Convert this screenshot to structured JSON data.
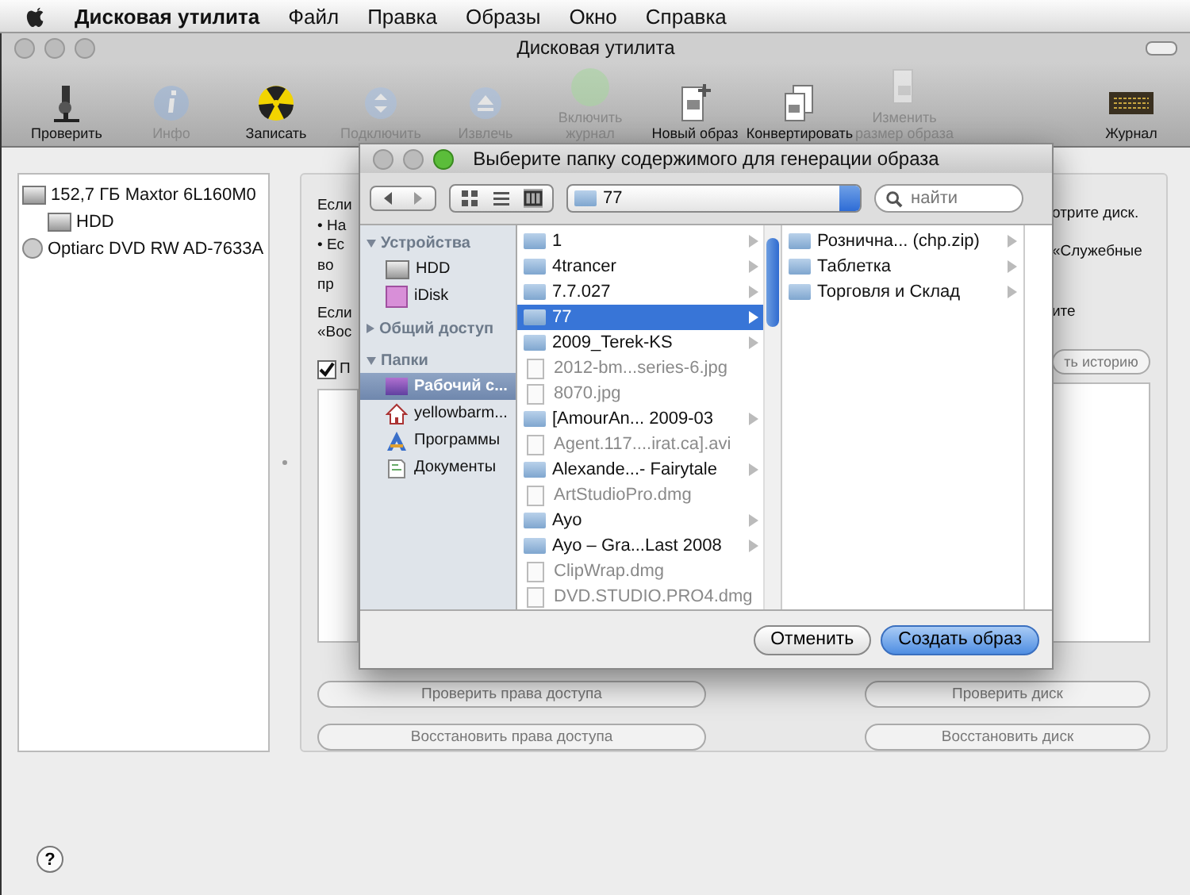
{
  "menu_bar": {
    "app": "Дисковая утилита",
    "items": [
      "Файл",
      "Правка",
      "Образы",
      "Окно",
      "Справка"
    ]
  },
  "window": {
    "title": "Дисковая утилита",
    "help_button": "?"
  },
  "toolbar": [
    {
      "label": "Проверить",
      "kind": "microscope",
      "disabled": false
    },
    {
      "label": "Инфо",
      "kind": "info",
      "disabled": true
    },
    {
      "label": "Записать",
      "kind": "burn",
      "disabled": false
    },
    {
      "label": "Подключить",
      "kind": "mount",
      "disabled": true
    },
    {
      "label": "Извлечь",
      "kind": "eject",
      "disabled": true
    },
    {
      "label": "Включить журнал",
      "kind": "journal",
      "disabled": true
    },
    {
      "label": "Новый образ",
      "kind": "new-image",
      "disabled": false
    },
    {
      "label": "Конвертировать",
      "kind": "convert",
      "disabled": false
    },
    {
      "label": "Изменить размер образа",
      "kind": "resize",
      "disabled": true
    },
    {
      "label": "Журнал",
      "kind": "log",
      "disabled": false
    }
  ],
  "disks": [
    {
      "label": "152,7 ГБ Maxtor 6L160M0",
      "kind": "disk",
      "children": [
        {
          "label": "HDD",
          "kind": "disk"
        }
      ]
    },
    {
      "label": "Optiarc DVD RW AD-7633A",
      "kind": "optical"
    }
  ],
  "first_aid": {
    "left_fragments": [
      "Если",
      "• На",
      "• Ес",
      "во",
      "пр",
      "Если",
      "«Вос"
    ],
    "right_fragments": [
      "отрите диск.",
      "«Служебные",
      "ите"
    ],
    "checkbox": {
      "label": "П",
      "checked": true
    },
    "history_button": "ть историю",
    "buttons": [
      {
        "label": "Проверить права доступа",
        "disabled": true
      },
      {
        "label": "Проверить диск",
        "disabled": true
      },
      {
        "label": "Восстановить права доступа",
        "disabled": true
      },
      {
        "label": "Восстановить диск",
        "disabled": true
      }
    ]
  },
  "dialog": {
    "title": "Выберите папку содержимого для генерации образа",
    "path": "77",
    "search": {
      "placeholder": "найти"
    },
    "sidebar": [
      {
        "heading": "Устройства",
        "expanded": true,
        "items": [
          {
            "label": "HDD",
            "kind": "disk",
            "selected": false
          },
          {
            "label": "iDisk",
            "kind": "idisk",
            "selected": false
          }
        ]
      },
      {
        "heading": "Общий доступ",
        "expanded": false
      },
      {
        "heading": "Папки",
        "expanded": true,
        "items": [
          {
            "label": "Рабочий с...",
            "kind": "desktop",
            "selected": true
          },
          {
            "label": "yellowbarm...",
            "kind": "home",
            "selected": false
          },
          {
            "label": "Программы",
            "kind": "apps",
            "selected": false
          },
          {
            "label": "Документы",
            "kind": "docs",
            "selected": false
          }
        ]
      }
    ],
    "columns": [
      [
        {
          "name": "1",
          "kind": "folder",
          "selected": false
        },
        {
          "name": "4trancer",
          "kind": "folder",
          "selected": false
        },
        {
          "name": "7.7.027",
          "kind": "folder",
          "selected": false
        },
        {
          "name": "77",
          "kind": "folder",
          "selected": true
        },
        {
          "name": "2009_Terek-KS",
          "kind": "folder",
          "selected": false
        },
        {
          "name": "2012-bm...series-6.jpg",
          "kind": "file",
          "selected": false
        },
        {
          "name": "8070.jpg",
          "kind": "file",
          "selected": false
        },
        {
          "name": "[AmourAn... 2009-03",
          "kind": "folder",
          "selected": false
        },
        {
          "name": "Agent.117....irat.ca].avi",
          "kind": "file",
          "selected": false
        },
        {
          "name": "Alexande...- Fairytale",
          "kind": "folder",
          "selected": false
        },
        {
          "name": "ArtStudioPro.dmg",
          "kind": "file",
          "selected": false
        },
        {
          "name": "Ayo",
          "kind": "folder",
          "selected": false
        },
        {
          "name": "Ayo – Gra...Last 2008",
          "kind": "folder",
          "selected": false
        },
        {
          "name": "ClipWrap.dmg",
          "kind": "file",
          "selected": false
        },
        {
          "name": "DVD.STUDIO.PRO4.dmg",
          "kind": "file",
          "selected": false
        }
      ],
      [
        {
          "name": "Рознична... (chp.zip)",
          "kind": "folder",
          "selected": false
        },
        {
          "name": "Таблетка",
          "kind": "folder",
          "selected": false
        },
        {
          "name": "Торговля и Склад",
          "kind": "folder",
          "selected": false
        }
      ]
    ],
    "buttons": [
      {
        "label": "Отменить",
        "default": false
      },
      {
        "label": "Создать образ",
        "default": true
      }
    ]
  }
}
